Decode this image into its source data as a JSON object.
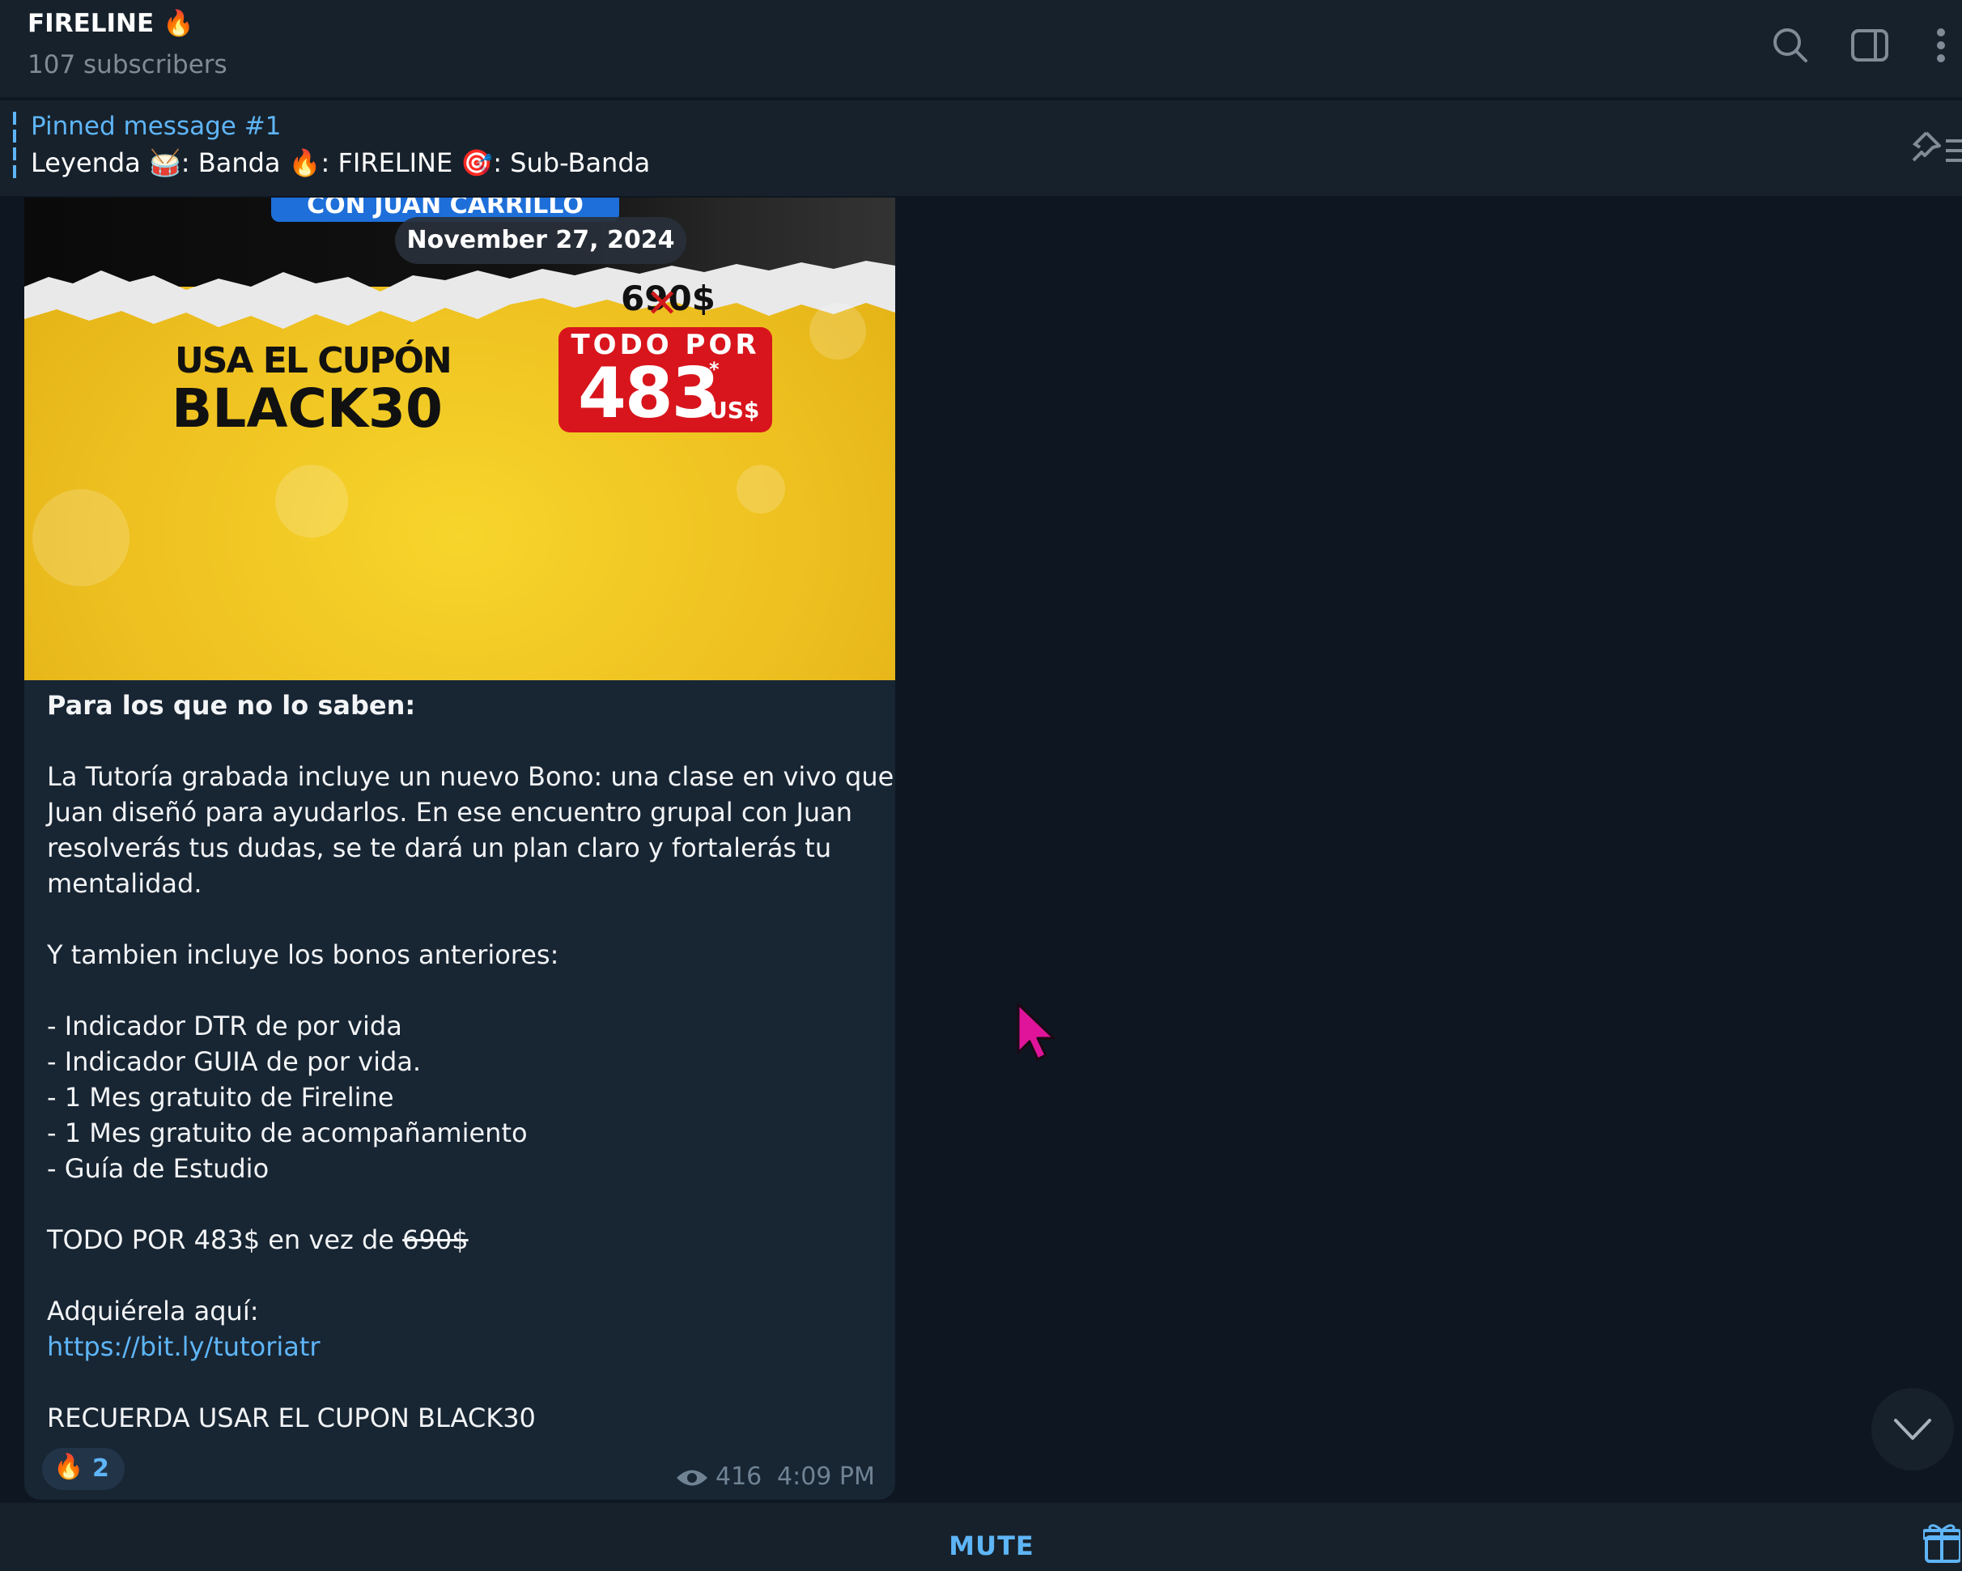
{
  "header": {
    "title": "FIRELINE 🔥",
    "subtitle": "107 subscribers",
    "icons": [
      "search-icon",
      "sidebar-toggle-icon",
      "more-vertical-icon"
    ]
  },
  "pinned": {
    "title": "Pinned message #1",
    "text": "Leyenda 🥁: Banda  🔥: FIRELINE  🎯: Sub-Banda"
  },
  "message": {
    "date_badge": "November 27, 2024",
    "image": {
      "banner_text": "CON JUAN CARRILLO",
      "coupon_line1": "USA EL CUPÓN",
      "coupon_line2": "BLACK30",
      "old_price": "690$",
      "price_label": "TODO POR",
      "price_value": "483",
      "price_star": "*",
      "price_currency": "US$"
    },
    "lines": {
      "l1": "Para los que no lo saben:",
      "l2": "La Tutoría grabada incluye un nuevo Bono: una clase en vivo que",
      "l3": "Juan diseñó para ayudarlos. En ese encuentro grupal con Juan",
      "l4": "resolverás tus dudas, se te dará un plan claro y fortalerás tu",
      "l5": "mentalidad.",
      "l6": "Y tambien incluye los bonos anteriores:",
      "l7": "- Indicador DTR de por vida",
      "l8": "- Indicador GUIA de por vida.",
      "l9": "- 1 Mes gratuito de Fireline",
      "l10": "- 1 Mes gratuito de acompañamiento",
      "l11": "- Guía de Estudio",
      "l12a": "TODO POR 483$ en vez de ",
      "l12b": "690$",
      "l13": "Adquiérela aquí:",
      "link": "https://bit.ly/tutoriatr",
      "l14": "RECUERDA USAR EL CUPON BLACK30"
    },
    "reaction": {
      "emoji": "🔥",
      "count": "2"
    },
    "views": "416",
    "time": "4:09 PM"
  },
  "bottom": {
    "mute_label": "MUTE"
  },
  "colors": {
    "accent": "#5eb5f7",
    "background": "#0e1621",
    "panel": "#17212b",
    "bubble": "#182533",
    "cursor": "#e0149a"
  }
}
